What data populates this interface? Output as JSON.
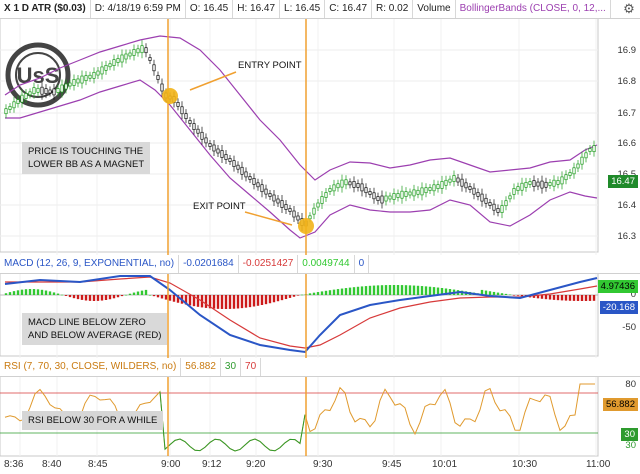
{
  "price_header": {
    "symbol": "X 1 D ATR ($0.03)",
    "date": "D: 4/18/19 6:59 PM",
    "open": "O: 16.45",
    "high": "H: 16.47",
    "low": "L: 16.45",
    "close": "C: 16.47",
    "range": "R: 0.02",
    "volume": "Volume",
    "study": "BollingerBands (CLOSE, 0, 12,..."
  },
  "price_axis": {
    "ticks": [
      "16.9",
      "16.8",
      "16.7",
      "16.6",
      "16.5",
      "16.4",
      "16.3"
    ],
    "last": "16.47",
    "last_color": "#1f8a2a"
  },
  "macd_header": {
    "name": "MACD (12, 26, 9, EXPONENTIAL, no)",
    "v1": "-0.0201684",
    "v2": "-0.0251427",
    "v3": "0.0049744",
    "v4": "0"
  },
  "macd_axis": {
    "ticks": [
      "0",
      "-50"
    ],
    "last_hist": "4.97436",
    "last_line": "-20.168"
  },
  "rsi_header": {
    "name": "RSI (7, 70, 30, CLOSE, WILDERS, no)",
    "value": "56.882",
    "low": "30",
    "high": "70"
  },
  "rsi_axis": {
    "ticks": [
      "80",
      "30"
    ],
    "last": "56.882",
    "oversold": "30"
  },
  "time_axis": [
    "8:36",
    "8:40",
    "8:45",
    "9:00",
    "9:12",
    "9:20",
    "9:30",
    "9:45",
    "10:01",
    "10:30",
    "11:00"
  ],
  "annotations": {
    "entry": "ENTRY POINT",
    "exit": "EXIT POINT",
    "price_note": [
      "PRICE IS TOUCHING THE",
      "LOWER BB AS A MAGNET"
    ],
    "macd_note": [
      "MACD LINE BELOW ZERO",
      "AND BELOW AVERAGE (RED)"
    ],
    "rsi_note": "RSI BELOW 30 FOR A WHILE"
  },
  "logo_text": "UsS",
  "colors": {
    "bb": "#9c3fb0",
    "macd_line": "#2a56c6",
    "macd_avg": "#d73a3a",
    "up": "#32c832",
    "down": "#cc1a1a",
    "marker": "#f2b418",
    "vline": "#f0a030",
    "rsi": "#e09a2e",
    "rsi_low": "#2e9b2e"
  }
}
